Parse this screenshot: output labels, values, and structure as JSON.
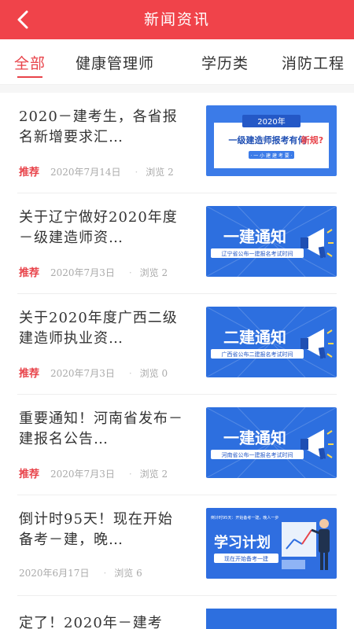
{
  "header": {
    "title": "新闻资讯",
    "back_icon": "chevron-left-icon"
  },
  "tabs": [
    {
      "label": "全部",
      "active": true
    },
    {
      "label": "健康管理师",
      "active": false
    },
    {
      "label": "学历类",
      "active": false
    },
    {
      "label": "消防工程",
      "active": false
    }
  ],
  "news": [
    {
      "title": "2020－建考生，各省报名新增要求汇…",
      "tag": "推荐",
      "date": "2020年7月14日",
      "views": "浏览 2",
      "thumb": {
        "type": "notice",
        "year": "2020年",
        "headline": "一级建造师报考有何",
        "highlight": "新规?",
        "footer": "· 一 小 建 建 考 要 ·"
      }
    },
    {
      "title": "关于辽宁做好2020年度－级建造师资…",
      "tag": "推荐",
      "date": "2020年7月3日",
      "views": "浏览 2",
      "thumb": {
        "type": "banner",
        "headline": "一建通知",
        "sub": "辽宁省公布一建报名考试时间"
      }
    },
    {
      "title": "关于2020年度广西二级建造师执业资…",
      "tag": "推荐",
      "date": "2020年7月3日",
      "views": "浏览 0",
      "thumb": {
        "type": "banner",
        "headline": "二建通知",
        "sub": "广西省公布二建报名考试时间"
      }
    },
    {
      "title": "重要通知！河南省发布－建报名公告…",
      "tag": "推荐",
      "date": "2020年7月3日",
      "views": "浏览 2",
      "thumb": {
        "type": "banner",
        "headline": "一建通知",
        "sub": "河南省公布一建报名考试时间"
      }
    },
    {
      "title": "倒计时95天！现在开始备考－建，晚…",
      "tag": "",
      "date": "2020年6月17日",
      "views": "浏览 6",
      "thumb": {
        "type": "plan",
        "top": "倒计时95天：开始备考一建，晚人一步",
        "headline": "学习计划",
        "sub": "现在开始备考一建"
      }
    }
  ],
  "last_item": {
    "title": "定了！2020年－建考"
  },
  "colors": {
    "brand_red": "#f0434a",
    "thumb_blue": "#2d6fdf"
  }
}
